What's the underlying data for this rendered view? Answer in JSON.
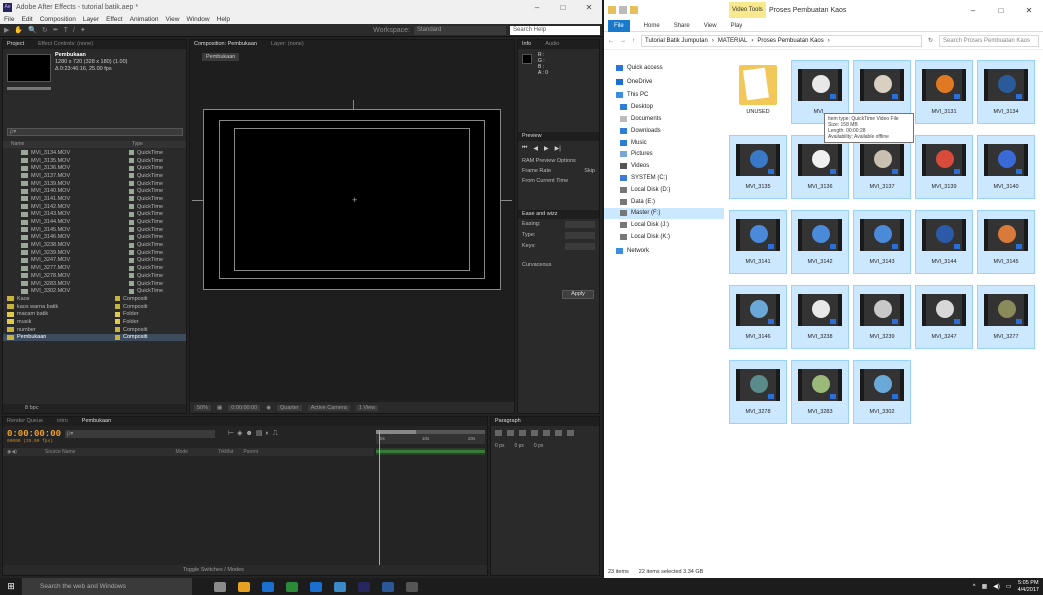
{
  "ae": {
    "title": "Adobe After Effects - tutorial batik.aep *",
    "menu": [
      "File",
      "Edit",
      "Composition",
      "Layer",
      "Effect",
      "Animation",
      "View",
      "Window",
      "Help"
    ],
    "workspace_label": "Workspace:",
    "workspace_value": "Standard",
    "search_help": "Search Help",
    "project_tab": "Project",
    "effect_controls_tab": "Effect Controls: (none)",
    "project_item_name": "Pembukaan",
    "project_item_info1": "1280 x 720 (328 x 180) (1.00)",
    "project_item_info2": "Δ 0:23:46:16, 25.00 fps",
    "project_search": "ρ▾",
    "col_name": "Name",
    "col_type": "Type",
    "bpc": "8 bpc",
    "project_rows": [
      {
        "name": "MVI_3134.MOV",
        "type": "QuickTime",
        "kind": "file",
        "color": "#9aa89a"
      },
      {
        "name": "MVI_3135.MOV",
        "type": "QuickTime",
        "kind": "file",
        "color": "#9aa89a"
      },
      {
        "name": "MVI_3136.MOV",
        "type": "QuickTime",
        "kind": "file",
        "color": "#9aa89a"
      },
      {
        "name": "MVI_3137.MOV",
        "type": "QuickTime",
        "kind": "file",
        "color": "#9aa89a"
      },
      {
        "name": "MVI_3139.MOV",
        "type": "QuickTime",
        "kind": "file",
        "color": "#9aa89a"
      },
      {
        "name": "MVI_3140.MOV",
        "type": "QuickTime",
        "kind": "file",
        "color": "#9aa89a"
      },
      {
        "name": "MVI_3141.MOV",
        "type": "QuickTime",
        "kind": "file",
        "color": "#9aa89a"
      },
      {
        "name": "MVI_3142.MOV",
        "type": "QuickTime",
        "kind": "file",
        "color": "#9aa89a"
      },
      {
        "name": "MVI_3143.MOV",
        "type": "QuickTime",
        "kind": "file",
        "color": "#9aa89a"
      },
      {
        "name": "MVI_3144.MOV",
        "type": "QuickTime",
        "kind": "file",
        "color": "#9aa89a"
      },
      {
        "name": "MVI_3145.MOV",
        "type": "QuickTime",
        "kind": "file",
        "color": "#9aa89a"
      },
      {
        "name": "MVI_3146.MOV",
        "type": "QuickTime",
        "kind": "file",
        "color": "#9aa89a"
      },
      {
        "name": "MVI_3238.MOV",
        "type": "QuickTime",
        "kind": "file",
        "color": "#9aa89a"
      },
      {
        "name": "MVI_3239.MOV",
        "type": "QuickTime",
        "kind": "file",
        "color": "#9aa89a"
      },
      {
        "name": "MVI_3247.MOV",
        "type": "QuickTime",
        "kind": "file",
        "color": "#9aa89a"
      },
      {
        "name": "MVI_3277.MOV",
        "type": "QuickTime",
        "kind": "file",
        "color": "#9aa89a"
      },
      {
        "name": "MVI_3278.MOV",
        "type": "QuickTime",
        "kind": "file",
        "color": "#9aa89a"
      },
      {
        "name": "MVI_3283.MOV",
        "type": "QuickTime",
        "kind": "file",
        "color": "#9aa89a"
      },
      {
        "name": "MVI_3302.MOV",
        "type": "QuickTime",
        "kind": "file",
        "color": "#9aa89a"
      },
      {
        "name": "Kaos",
        "type": "Compositi",
        "kind": "comp",
        "color": "#c7b23a"
      },
      {
        "name": "kaos warna batik",
        "type": "Compositi",
        "kind": "comp",
        "color": "#c7b23a"
      },
      {
        "name": "macam batik",
        "type": "Folder",
        "kind": "folder",
        "color": "#e0c84a"
      },
      {
        "name": "musik",
        "type": "Folder",
        "kind": "folder",
        "color": "#e0c84a"
      },
      {
        "name": "number",
        "type": "Compositi",
        "kind": "comp",
        "color": "#c7b23a"
      },
      {
        "name": "Pembukaan",
        "type": "Compositi",
        "kind": "comp",
        "color": "#c7b23a",
        "selected": true
      }
    ],
    "comp_tab": "Composition: Pembukaan",
    "layer_tab": "Layer: (none)",
    "comp_name": "Pembukaan",
    "zoom": "50%",
    "comp_time": "0:00:00:00",
    "quality": "Quarter",
    "active_camera": "Active Camera",
    "view_count": "1 View",
    "info_tab": "Info",
    "audio_tab": "Audio",
    "info_rgb": "R :\nG :\nB :\nA : 0",
    "preview_tab": "Preview",
    "ram_preview": "RAM Preview Options",
    "frame_rate": "Frame Rate",
    "skip": "Skip",
    "from_current": "From Current Time",
    "ease_tab": "Ease and wizz",
    "easing": "Easing:",
    "type": "Type:",
    "keys": "Keys:",
    "curvaceous": "Curvaceous",
    "apply": "Apply",
    "render_queue_tab": "Render Queue",
    "intro_tab": "intro",
    "timeline_tab": "Pembukaan",
    "timecode": "0:00:00:00",
    "timecode_sub": "00000 (25.00 fps)",
    "timeline_search": "ρ▾",
    "col_source": "Source Name",
    "col_mode": "Mode",
    "col_trkmat": "TrkMat",
    "col_parent": "Parent",
    "ruler_marks": [
      "0s",
      "10s",
      "20s"
    ],
    "toggle_label": "Toggle Switches / Modes",
    "paragraph_tab": "Paragraph",
    "para_px1": "0 px",
    "para_px2": "0 px",
    "para_px3": "0 px"
  },
  "explorer": {
    "video_tools": "Video Tools",
    "title": "Proses Pembuatan Kaos",
    "ribbon": [
      "File",
      "Home",
      "Share",
      "View",
      "Play"
    ],
    "path": [
      "Tutorial Batik Jumputan",
      "MATERIAL",
      "Proses Pembuatan Kaos"
    ],
    "search_placeholder": "Search Proses Pembuatan Kaos",
    "nav": [
      {
        "label": "Quick access",
        "color": "#2a78d6",
        "sub": false
      },
      {
        "label": "OneDrive",
        "color": "#1b6fd1",
        "sub": false
      },
      {
        "label": "This PC",
        "color": "#3d8ee0",
        "sub": false
      },
      {
        "label": "Desktop",
        "color": "#2d7fd6",
        "sub": true
      },
      {
        "label": "Documents",
        "color": "#bbbbbb",
        "sub": true
      },
      {
        "label": "Downloads",
        "color": "#2d7fd6",
        "sub": true
      },
      {
        "label": "Music",
        "color": "#2d7fd6",
        "sub": true
      },
      {
        "label": "Pictures",
        "color": "#7aa6d6",
        "sub": true
      },
      {
        "label": "Videos",
        "color": "#555555",
        "sub": true
      },
      {
        "label": "SYSTEM (C:)",
        "color": "#3b7ad6",
        "sub": true
      },
      {
        "label": "Local Disk (D:)",
        "color": "#777777",
        "sub": true
      },
      {
        "label": "Data (E:)",
        "color": "#777777",
        "sub": true
      },
      {
        "label": "Master (F:)",
        "color": "#777777",
        "sub": true,
        "selected": true
      },
      {
        "label": "Local Disk (J:)",
        "color": "#777777",
        "sub": true
      },
      {
        "label": "Local Disk (K:)",
        "color": "#777777",
        "sub": true
      },
      {
        "label": "Network",
        "color": "#3d8ee0",
        "sub": false
      }
    ],
    "items": [
      {
        "name": "UNUSED",
        "folder": true
      },
      {
        "name": "MVI_",
        "color": "#e8e8e8"
      },
      {
        "name": "",
        "color": "#d8d0c0"
      },
      {
        "name": "MVI_3131",
        "color": "#e07a22"
      },
      {
        "name": "MVI_3134",
        "color": "#2a5a9a"
      },
      {
        "name": "MVI_3135",
        "color": "#3a78c8"
      },
      {
        "name": "MVI_3136",
        "color": "#f0f0f0"
      },
      {
        "name": "MVI_3137",
        "color": "#c8c0b0"
      },
      {
        "name": "MVI_3139",
        "color": "#d84a3a"
      },
      {
        "name": "MVI_3140",
        "color": "#3a6ad8"
      },
      {
        "name": "MVI_3141",
        "color": "#4a8ad8"
      },
      {
        "name": "MVI_3142",
        "color": "#4a8ad8"
      },
      {
        "name": "MVI_3143",
        "color": "#4a8ad8"
      },
      {
        "name": "MVI_3144",
        "color": "#2a5aa8"
      },
      {
        "name": "MVI_3145",
        "color": "#d87a3a"
      },
      {
        "name": "MVI_3146",
        "color": "#6aa8d8"
      },
      {
        "name": "MVI_3238",
        "color": "#e8e8e8"
      },
      {
        "name": "MVI_3239",
        "color": "#c8c8c8"
      },
      {
        "name": "MVI_3247",
        "color": "#d8d8d8"
      },
      {
        "name": "MVI_3277",
        "color": "#8a8a5a"
      },
      {
        "name": "MVI_3278",
        "color": "#5a8a8a"
      },
      {
        "name": "MVI_3283",
        "color": "#9ab87a"
      },
      {
        "name": "MVI_3302",
        "color": "#6aa8d8"
      }
    ],
    "tooltip": "Item type: QuickTime Video File\nSize: 158 MB\nLength: 00:00:28\nAvailability: Available offline",
    "status_items": "23 items",
    "status_selected": "22 items selected  3.34 GB"
  },
  "taskbar": {
    "search_placeholder": "Search the web and Windows",
    "apps": [
      "#8a8a8a",
      "#e8a020",
      "#1b6fd1",
      "#2a8a3a",
      "#1b6fd1",
      "#3a8ac8",
      "#27265e",
      "#2b5797",
      "#555555"
    ],
    "time": "5:05 PM",
    "date": "4/4/2017"
  }
}
